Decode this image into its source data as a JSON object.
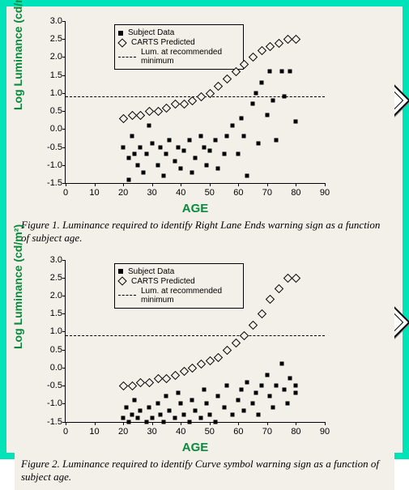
{
  "figure1": {
    "ylabel_html": "Log Luminance (cd/m²)",
    "xlabel": "AGE",
    "legend": {
      "s1": "Subject Data",
      "s2": "CARTS Predicted",
      "s3": "Lum. at recommended minimum"
    },
    "caption": "Figure 1. Luminance required to identify Right Lane Ends warning sign as a function of subject age.",
    "sign_text": "RIGHT\nLANE\nENDS"
  },
  "figure2": {
    "ylabel_html": "Log Luminance (cd/m²)",
    "xlabel": "AGE",
    "legend": {
      "s1": "Subject Data",
      "s2": "CARTS Predicted",
      "s3": "Lum. at recommended minimum"
    },
    "caption": "Figure 2.  Luminance required to identify Curve symbol warning sign as a function of subject age."
  },
  "axes": {
    "y_ticks": [
      "-1.5",
      "-1.0",
      "-0.5",
      "0.0",
      "0.5",
      "1.0",
      "1.5",
      "2.0",
      "2.5",
      "3.0"
    ],
    "x_ticks": [
      "0",
      "10",
      "20",
      "30",
      "40",
      "50",
      "60",
      "70",
      "80",
      "90"
    ],
    "y_min": -1.5,
    "y_max": 3.0,
    "x_min": 0,
    "x_max": 90,
    "ref_y": 0.9
  },
  "chart_data": [
    {
      "id": "figure1",
      "type": "scatter",
      "title": "Luminance required to identify Right Lane Ends warning sign as a function of subject age",
      "xlabel": "AGE",
      "ylabel": "Log Luminance (cd/m²)",
      "xlim": [
        0,
        90
      ],
      "ylim": [
        -1.5,
        3.0
      ],
      "reference_line": {
        "y": 0.9,
        "label": "Lum. at recommended minimum"
      },
      "series": [
        {
          "name": "Subject Data",
          "marker": "filled-square",
          "points": [
            [
              20,
              -0.5
            ],
            [
              22,
              -0.8
            ],
            [
              22,
              -1.4
            ],
            [
              23,
              -0.2
            ],
            [
              24,
              -0.7
            ],
            [
              25,
              -1.0
            ],
            [
              26,
              -0.5
            ],
            [
              27,
              -1.2
            ],
            [
              28,
              -0.7
            ],
            [
              29,
              0.1
            ],
            [
              30,
              -0.4
            ],
            [
              32,
              -1.0
            ],
            [
              33,
              -0.5
            ],
            [
              34,
              -1.3
            ],
            [
              35,
              -0.7
            ],
            [
              36,
              -0.3
            ],
            [
              38,
              -0.9
            ],
            [
              39,
              -0.5
            ],
            [
              40,
              -1.1
            ],
            [
              41,
              -0.6
            ],
            [
              43,
              -0.3
            ],
            [
              44,
              -1.2
            ],
            [
              45,
              -0.8
            ],
            [
              47,
              -0.2
            ],
            [
              48,
              -0.5
            ],
            [
              49,
              -1.0
            ],
            [
              50,
              -0.6
            ],
            [
              52,
              -0.3
            ],
            [
              53,
              -1.1
            ],
            [
              55,
              -0.7
            ],
            [
              56,
              -0.2
            ],
            [
              58,
              0.1
            ],
            [
              60,
              -0.7
            ],
            [
              61,
              0.3
            ],
            [
              62,
              -0.2
            ],
            [
              63,
              -1.3
            ],
            [
              65,
              0.7
            ],
            [
              66,
              1.0
            ],
            [
              67,
              -0.4
            ],
            [
              68,
              1.3
            ],
            [
              70,
              0.4
            ],
            [
              71,
              1.6
            ],
            [
              72,
              0.8
            ],
            [
              73,
              -0.3
            ],
            [
              75,
              1.6
            ],
            [
              76,
              0.9
            ],
            [
              78,
              1.6
            ],
            [
              80,
              0.2
            ]
          ]
        },
        {
          "name": "CARTS Predicted",
          "marker": "open-diamond",
          "points": [
            [
              20,
              0.3
            ],
            [
              23,
              0.4
            ],
            [
              26,
              0.4
            ],
            [
              29,
              0.5
            ],
            [
              32,
              0.5
            ],
            [
              35,
              0.6
            ],
            [
              38,
              0.7
            ],
            [
              41,
              0.7
            ],
            [
              44,
              0.8
            ],
            [
              47,
              0.9
            ],
            [
              50,
              1.0
            ],
            [
              53,
              1.2
            ],
            [
              56,
              1.4
            ],
            [
              59,
              1.6
            ],
            [
              62,
              1.8
            ],
            [
              65,
              2.0
            ],
            [
              68,
              2.2
            ],
            [
              71,
              2.3
            ],
            [
              74,
              2.4
            ],
            [
              77,
              2.5
            ],
            [
              80,
              2.5
            ]
          ]
        }
      ]
    },
    {
      "id": "figure2",
      "type": "scatter",
      "title": "Luminance required to identify Curve symbol warning sign as a function of subject age",
      "xlabel": "AGE",
      "ylabel": "Log Luminance (cd/m²)",
      "xlim": [
        0,
        90
      ],
      "ylim": [
        -1.5,
        3.0
      ],
      "reference_line": {
        "y": 0.9,
        "label": "Lum. at recommended minimum"
      },
      "series": [
        {
          "name": "Subject Data",
          "marker": "filled-square",
          "points": [
            [
              20,
              -1.4
            ],
            [
              21,
              -1.1
            ],
            [
              22,
              -1.5
            ],
            [
              23,
              -1.3
            ],
            [
              24,
              -0.9
            ],
            [
              25,
              -1.4
            ],
            [
              26,
              -1.2
            ],
            [
              28,
              -1.5
            ],
            [
              29,
              -1.1
            ],
            [
              30,
              -1.4
            ],
            [
              32,
              -1.0
            ],
            [
              33,
              -1.3
            ],
            [
              34,
              -1.5
            ],
            [
              35,
              -0.8
            ],
            [
              36,
              -1.2
            ],
            [
              38,
              -1.4
            ],
            [
              39,
              -0.7
            ],
            [
              40,
              -1.0
            ],
            [
              41,
              -1.3
            ],
            [
              43,
              -1.5
            ],
            [
              44,
              -0.9
            ],
            [
              45,
              -1.2
            ],
            [
              47,
              -1.4
            ],
            [
              48,
              -0.6
            ],
            [
              49,
              -1.0
            ],
            [
              50,
              -1.3
            ],
            [
              52,
              -1.5
            ],
            [
              53,
              -0.8
            ],
            [
              55,
              -1.1
            ],
            [
              56,
              -0.5
            ],
            [
              58,
              -1.3
            ],
            [
              60,
              -0.9
            ],
            [
              61,
              -0.6
            ],
            [
              62,
              -1.2
            ],
            [
              63,
              -0.4
            ],
            [
              65,
              -1.0
            ],
            [
              66,
              -0.7
            ],
            [
              67,
              -1.3
            ],
            [
              68,
              -0.5
            ],
            [
              70,
              -0.2
            ],
            [
              71,
              -0.8
            ],
            [
              72,
              -1.1
            ],
            [
              73,
              -0.5
            ],
            [
              75,
              0.1
            ],
            [
              76,
              -0.6
            ],
            [
              77,
              -1.0
            ],
            [
              78,
              -0.3
            ],
            [
              80,
              -0.7
            ],
            [
              80,
              -0.5
            ]
          ]
        },
        {
          "name": "CARTS Predicted",
          "marker": "open-diamond",
          "points": [
            [
              20,
              -0.5
            ],
            [
              23,
              -0.5
            ],
            [
              26,
              -0.4
            ],
            [
              29,
              -0.4
            ],
            [
              32,
              -0.3
            ],
            [
              35,
              -0.3
            ],
            [
              38,
              -0.2
            ],
            [
              41,
              -0.1
            ],
            [
              44,
              0.0
            ],
            [
              47,
              0.1
            ],
            [
              50,
              0.2
            ],
            [
              53,
              0.3
            ],
            [
              56,
              0.5
            ],
            [
              59,
              0.7
            ],
            [
              62,
              0.9
            ],
            [
              65,
              1.2
            ],
            [
              68,
              1.5
            ],
            [
              71,
              1.9
            ],
            [
              74,
              2.2
            ],
            [
              77,
              2.5
            ],
            [
              80,
              2.5
            ]
          ]
        }
      ]
    }
  ]
}
